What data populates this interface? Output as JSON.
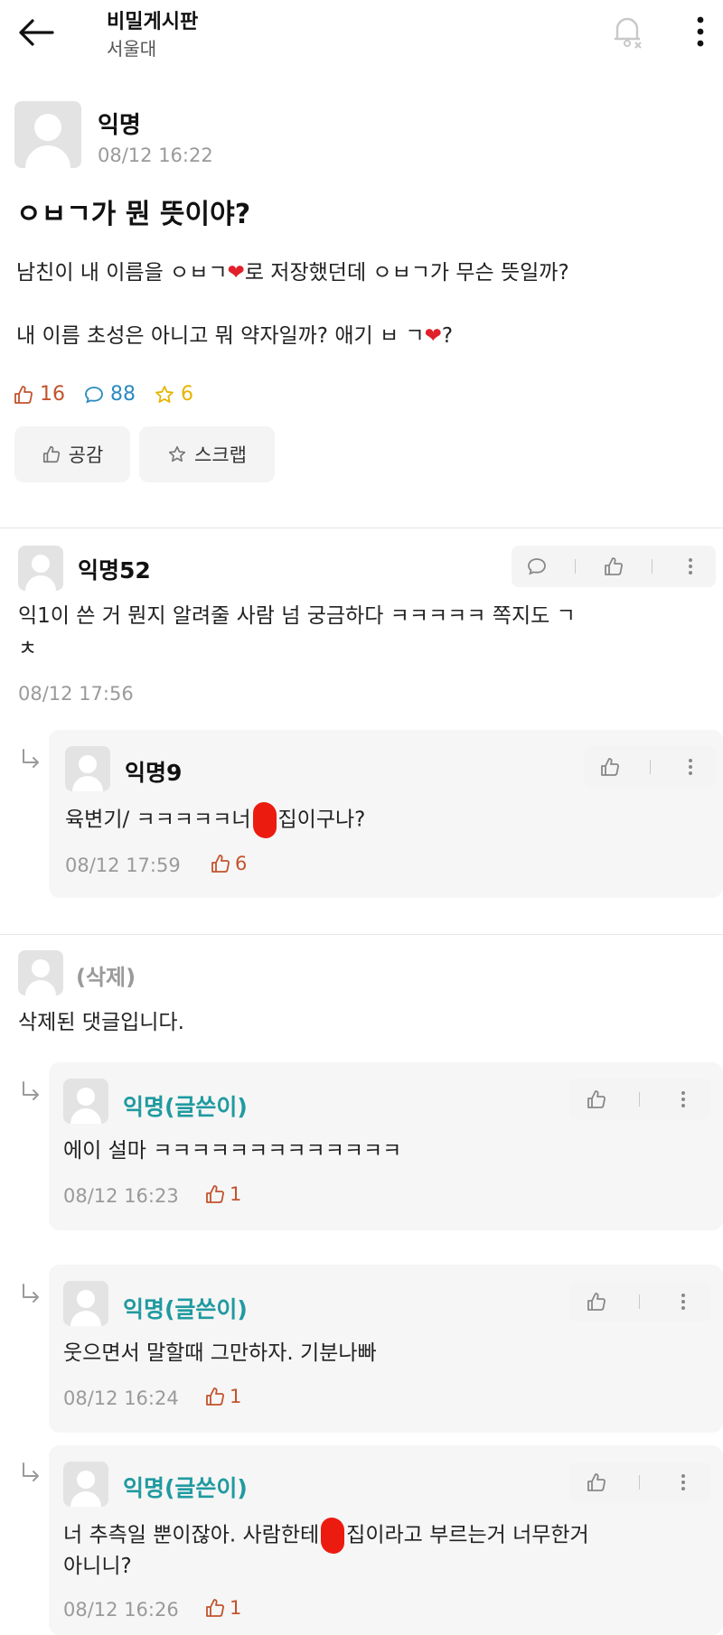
{
  "header": {
    "title": "비밀게시판",
    "subtitle": "서울대"
  },
  "post": {
    "author": "익명",
    "time": "08/12 16:22",
    "title": "ㅇㅂㄱ가 뭔 뜻이야?",
    "body_1_pre": "남친이 내 이름을 ㅇㅂㄱ",
    "body_1_post": "로 저장했던데 ㅇㅂㄱ가 무슨 뜻일까?",
    "body_2_pre": "내 이름 초성은 아니고 뭐 약자일까? 애기 ㅂ ㄱ",
    "body_2_post": "?",
    "heart": "❤",
    "likes": "16",
    "comments": "88",
    "scraps": "6",
    "like_button": "공감",
    "scrap_button": "스크랩"
  },
  "comments": [
    {
      "author": "익명52",
      "text_1": "익1이 쓴 거 뭔지 알려줄 사람 넘 궁금하다 ㅋㅋㅋㅋㅋ 쪽지도 ㄱ",
      "text_2": "ㅊ",
      "time": "08/12 17:56"
    },
    {
      "author": "익명9",
      "text_pre": "육변기/ ㅋㅋㅋㅋㅋ너",
      "text_post": "집이구나?",
      "time": "08/12 17:59",
      "likes": "6"
    },
    {
      "author": "(삭제)",
      "text": "삭제된 댓글입니다."
    },
    {
      "author": "익명(글쓴이)",
      "text": "에이 설마 ㅋㅋㅋㅋㅋㅋㅋㅋㅋㅋㅋㅋㅋ",
      "time": "08/12 16:23",
      "likes": "1"
    },
    {
      "author": "익명(글쓴이)",
      "text": "웃으면서 말할때 그만하자. 기분나빠",
      "time": "08/12 16:24",
      "likes": "1"
    },
    {
      "author": "익명(글쓴이)",
      "text_pre": "너 추측일 뿐이잖아. 사람한테",
      "text_post": "집이라고 부르는거 너무한거",
      "text_2": "아니니?",
      "time": "08/12 16:26",
      "likes": "1"
    }
  ],
  "colors": {
    "teal_author": "#1f9aa0",
    "like_red": "#c2532e",
    "comment_blue": "#2a8bc0",
    "scrap_yellow": "#e8b400",
    "heart_red": "#e0202a"
  }
}
